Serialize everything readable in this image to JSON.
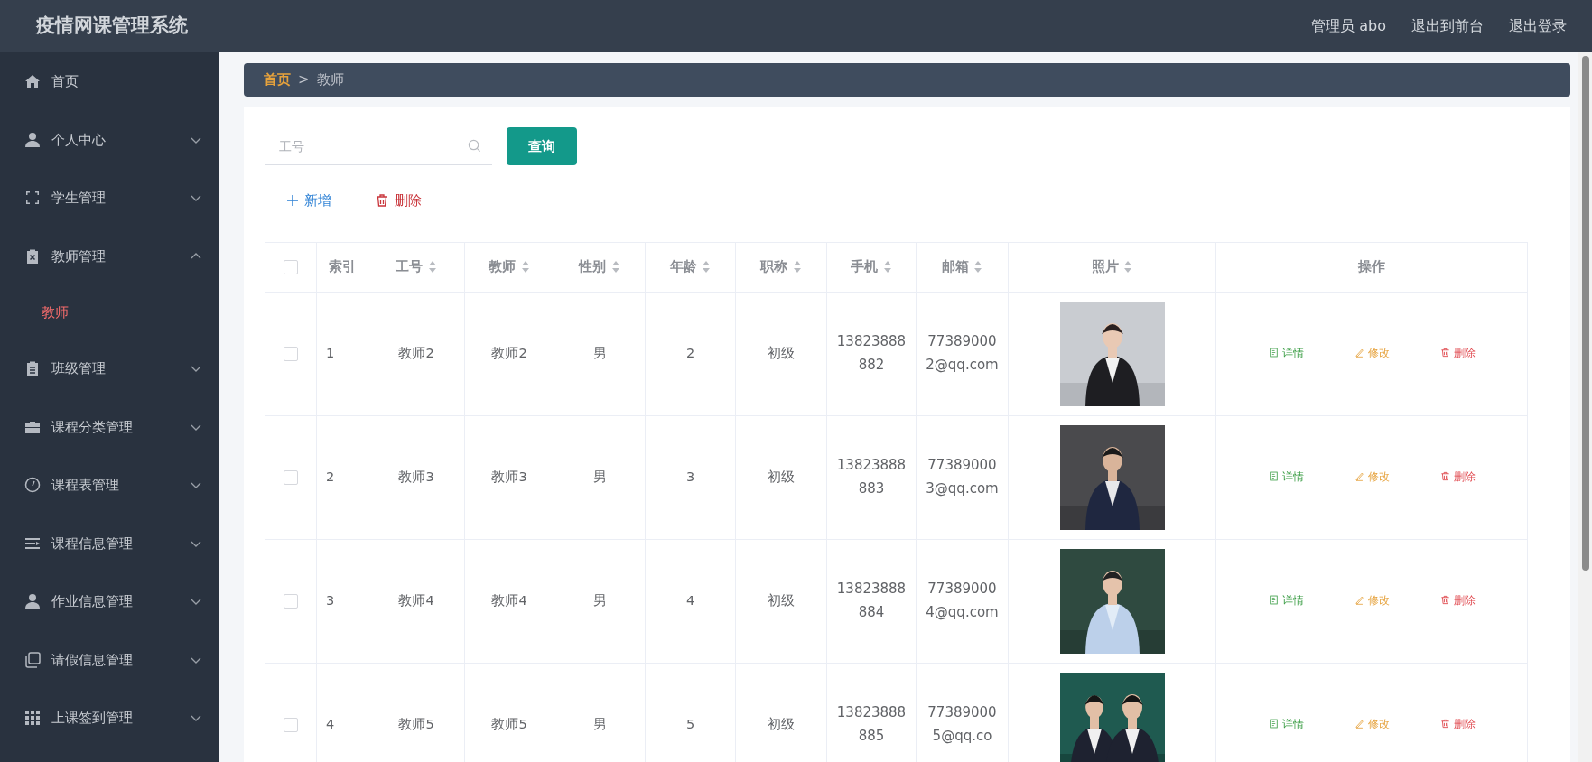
{
  "header": {
    "title": "疫情网课管理系统",
    "links": [
      "管理员 abo",
      "退出到前台",
      "退出登录"
    ]
  },
  "sidebar": {
    "items": [
      {
        "kind": "link",
        "label": "首页"
      },
      {
        "kind": "menu",
        "label": "个人中心",
        "expanded": false
      },
      {
        "kind": "menu",
        "label": "学生管理",
        "expanded": false
      },
      {
        "kind": "menu",
        "label": "教师管理",
        "expanded": true,
        "children": [
          {
            "label": "教师",
            "selected": true
          }
        ]
      },
      {
        "kind": "menu",
        "label": "班级管理",
        "expanded": false
      },
      {
        "kind": "menu",
        "label": "课程分类管理",
        "expanded": false
      },
      {
        "kind": "menu",
        "label": "课程表管理",
        "expanded": false
      },
      {
        "kind": "menu",
        "label": "课程信息管理",
        "expanded": false
      },
      {
        "kind": "menu",
        "label": "作业信息管理",
        "expanded": false
      },
      {
        "kind": "menu",
        "label": "请假信息管理",
        "expanded": false
      },
      {
        "kind": "menu",
        "label": "上课签到管理",
        "expanded": false
      }
    ]
  },
  "breadcrumb": {
    "items": [
      "首页",
      "教师"
    ],
    "separator": ">"
  },
  "search": {
    "placeholder": "工号",
    "button": "查询"
  },
  "toolbar": [
    {
      "kind": "add",
      "label": "新增"
    },
    {
      "kind": "delete",
      "label": "删除"
    }
  ],
  "table": {
    "select_all": {
      "checked": false
    },
    "columns": [
      {
        "label": "索引",
        "sortable": false
      },
      {
        "label": "工号",
        "sortable": true
      },
      {
        "label": "教师",
        "sortable": true
      },
      {
        "label": "性别",
        "sortable": true
      },
      {
        "label": "年龄",
        "sortable": true
      },
      {
        "label": "职称",
        "sortable": true
      },
      {
        "label": "手机",
        "sortable": true
      },
      {
        "label": "邮箱",
        "sortable": true
      },
      {
        "label": "照片",
        "sortable": true
      },
      {
        "label": "操作",
        "sortable": false
      }
    ],
    "rows": [
      {
        "checked": false,
        "index": "1",
        "id": "教师2",
        "name": "教师2",
        "gender": "男",
        "age": "2",
        "title": "初级",
        "phone": "13823888882",
        "email": "773890002@qq.com",
        "actions": [
          {
            "kind": "detail",
            "label": "详情"
          },
          {
            "kind": "edit",
            "label": "修改"
          },
          {
            "kind": "delete",
            "label": "删除"
          }
        ]
      },
      {
        "checked": false,
        "index": "2",
        "id": "教师3",
        "name": "教师3",
        "gender": "男",
        "age": "3",
        "title": "初级",
        "phone": "13823888883",
        "email": "773890003@qq.com",
        "actions": [
          {
            "kind": "detail",
            "label": "详情"
          },
          {
            "kind": "edit",
            "label": "修改"
          },
          {
            "kind": "delete",
            "label": "删除"
          }
        ]
      },
      {
        "checked": false,
        "index": "3",
        "id": "教师4",
        "name": "教师4",
        "gender": "男",
        "age": "4",
        "title": "初级",
        "phone": "13823888884",
        "email": "773890004@qq.com",
        "actions": [
          {
            "kind": "detail",
            "label": "详情"
          },
          {
            "kind": "edit",
            "label": "修改"
          },
          {
            "kind": "delete",
            "label": "删除"
          }
        ]
      },
      {
        "checked": false,
        "index": "4",
        "id": "教师5",
        "name": "教师5",
        "gender": "男",
        "age": "5",
        "title": "初级",
        "phone": "13823888885",
        "email": "773890005@qq.co",
        "actions": [
          {
            "kind": "detail",
            "label": "详情"
          },
          {
            "kind": "edit",
            "label": "修改"
          },
          {
            "kind": "delete",
            "label": "删除"
          }
        ]
      }
    ]
  }
}
